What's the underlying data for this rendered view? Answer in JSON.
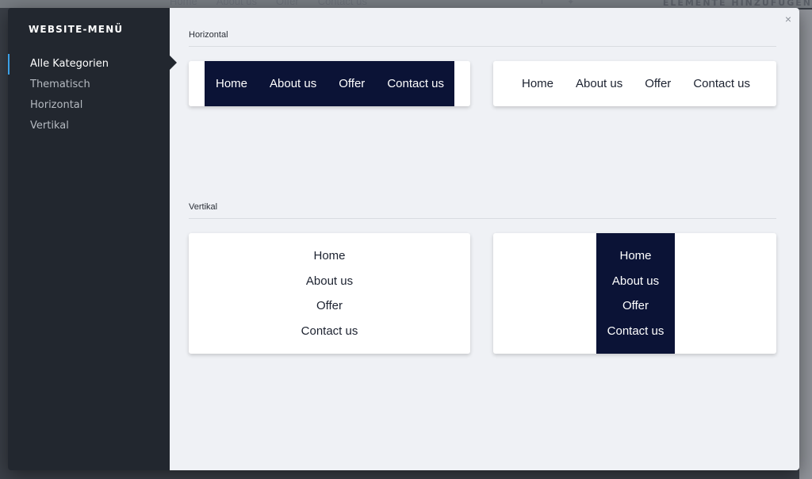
{
  "background": {
    "nav": [
      "Home",
      "About us",
      "Offer",
      "Contact us"
    ],
    "title": "ELEMENTE HINZUFÜGEN"
  },
  "sidebar": {
    "title": "WEBSITE-MENÜ",
    "items": [
      {
        "label": "Alle Kategorien",
        "active": true
      },
      {
        "label": "Thematisch",
        "active": false
      },
      {
        "label": "Horizontal",
        "active": false
      },
      {
        "label": "Vertikal",
        "active": false
      }
    ]
  },
  "content": {
    "close_label": "×",
    "sections": [
      {
        "label": "Horizontal",
        "cards": [
          {
            "style": "dark",
            "items": [
              "Home",
              "About us",
              "Offer",
              "Contact us"
            ]
          },
          {
            "style": "light",
            "items": [
              "Home",
              "About us",
              "Offer",
              "Contact us"
            ]
          }
        ]
      },
      {
        "label": "Vertikal",
        "cards": [
          {
            "style": "light",
            "items": [
              "Home",
              "About us",
              "Offer",
              "Contact us"
            ]
          },
          {
            "style": "dark",
            "items": [
              "Home",
              "About us",
              "Offer",
              "Contact us"
            ]
          }
        ]
      }
    ]
  },
  "colors": {
    "menu_dark": "#0b1336",
    "sidebar_bg": "#22272f",
    "content_bg": "#eff1f5",
    "accent": "#3ba0e6"
  }
}
